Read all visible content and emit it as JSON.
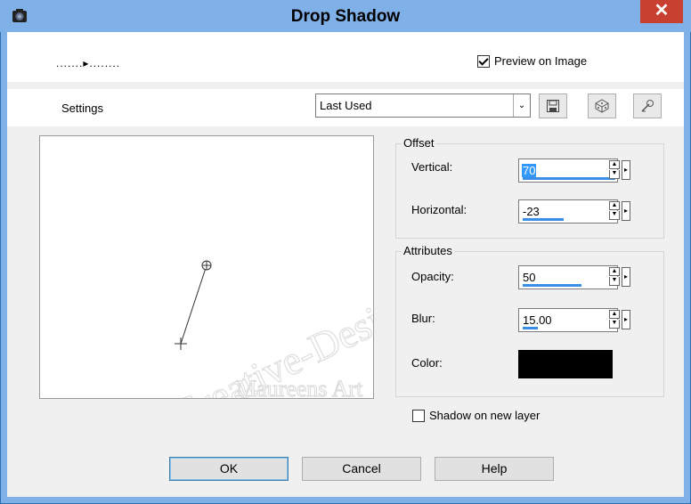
{
  "window": {
    "title": "Drop Shadow",
    "close_glyph": "✕"
  },
  "preview_on_image": {
    "label": "Preview on Image",
    "checked": true
  },
  "settings": {
    "label": "Settings",
    "selected": "Last Used"
  },
  "offset": {
    "title": "Offset",
    "vertical": {
      "label": "Vertical:",
      "value": "70"
    },
    "horizontal": {
      "label": "Horizontal:",
      "value": "-23"
    }
  },
  "attributes": {
    "title": "Attributes",
    "opacity": {
      "label": "Opacity:",
      "value": "50"
    },
    "blur": {
      "label": "Blur:",
      "value": "15.00"
    },
    "color": {
      "label": "Color:",
      "value": "#000000"
    }
  },
  "shadow_on_new_layer": {
    "label": "Shadow on new layer",
    "checked": false
  },
  "buttons": {
    "ok": "OK",
    "cancel": "Cancel",
    "help": "Help"
  },
  "watermark": {
    "line1": "Creative-Designs",
    "line2": "Maureens Art"
  }
}
